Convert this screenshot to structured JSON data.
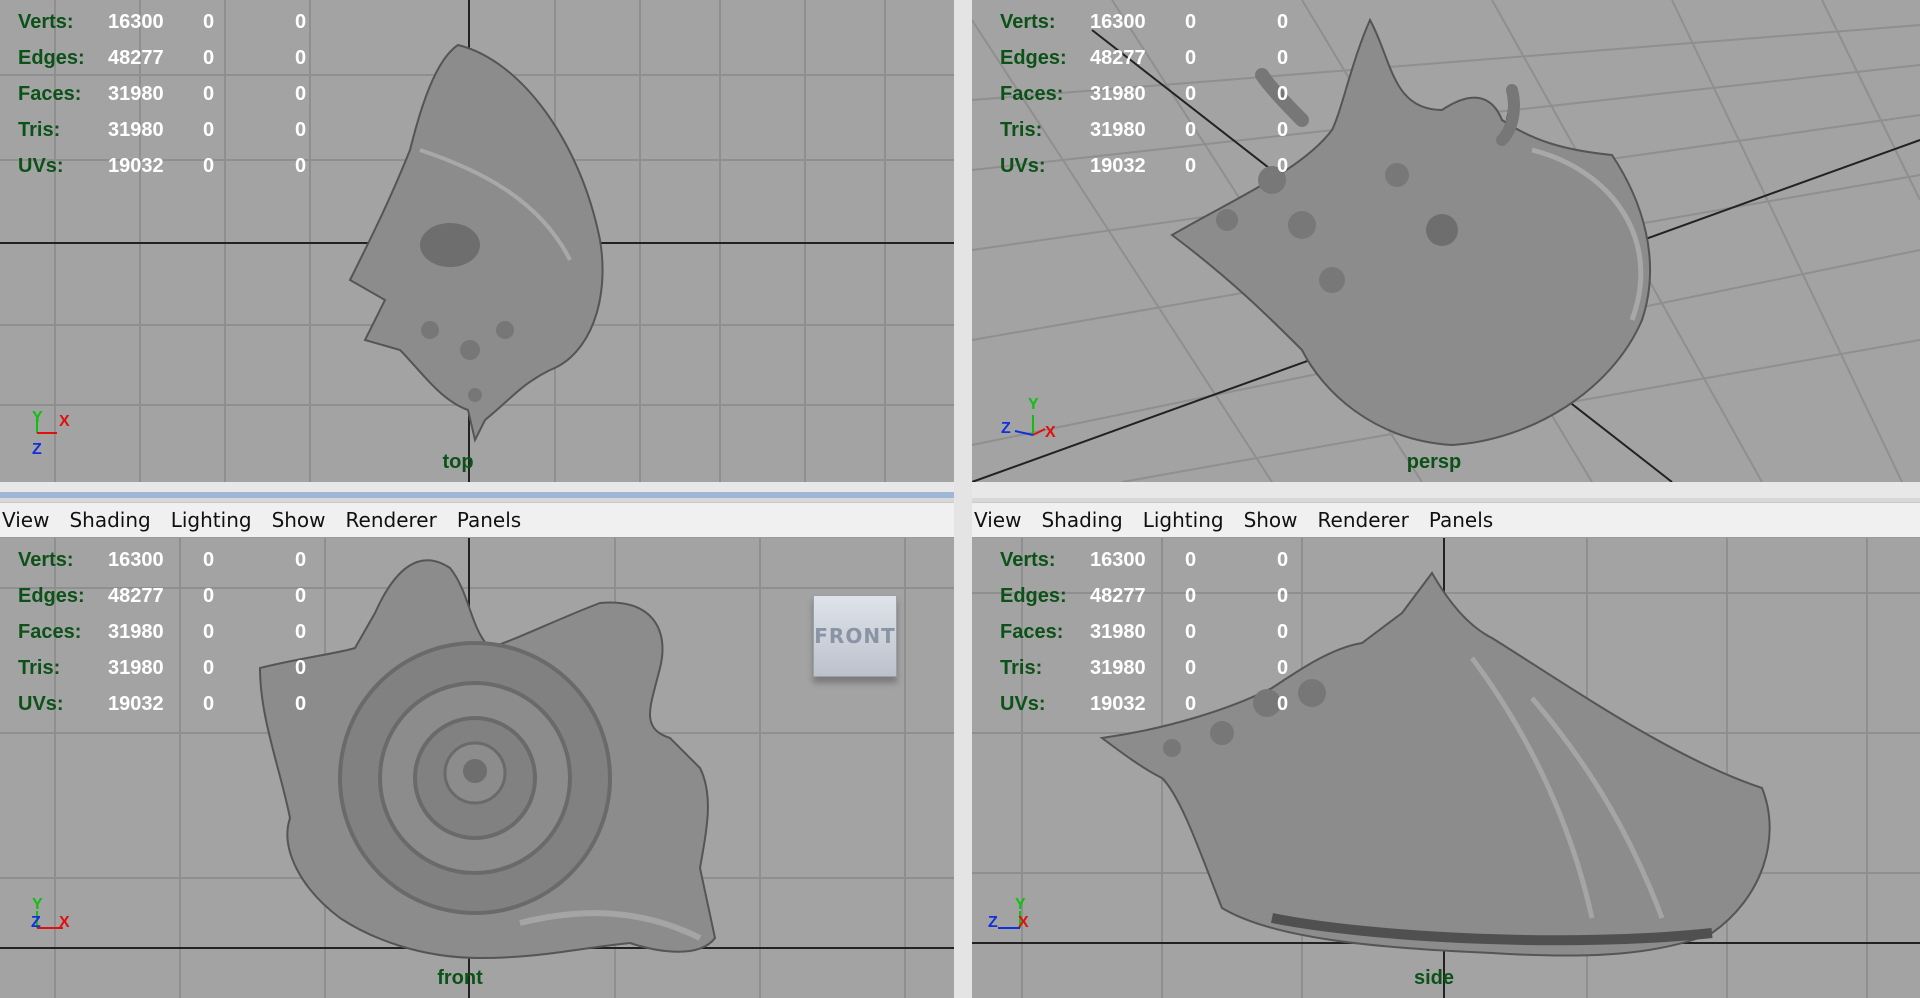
{
  "stats_rows": [
    {
      "label": "Verts:",
      "a": "16300",
      "b": "0",
      "c": "0"
    },
    {
      "label": "Edges:",
      "a": "48277",
      "b": "0",
      "c": "0"
    },
    {
      "label": "Faces:",
      "a": "31980",
      "b": "0",
      "c": "0"
    },
    {
      "label": "Tris:",
      "a": "31980",
      "b": "0",
      "c": "0"
    },
    {
      "label": "UVs:",
      "a": "19032",
      "b": "0",
      "c": "0"
    }
  ],
  "menu": [
    "View",
    "Shading",
    "Lighting",
    "Show",
    "Renderer",
    "Panels"
  ],
  "viewports": {
    "top": {
      "camera": "top"
    },
    "persp": {
      "camera": "persp"
    },
    "front": {
      "camera": "front",
      "viewcube": "FRONT"
    },
    "side": {
      "camera": "side"
    }
  },
  "axis_labels": {
    "x": "X",
    "y": "Y",
    "z": "Z"
  },
  "colors": {
    "viewport_bg": "#a3a3a3",
    "grid": "#8f8f8f",
    "axis_line": "#222222",
    "hud_label": "#0c5218",
    "hud_value": "#ffffff",
    "shell": "#8c8c8c",
    "axis_x": "#e01010",
    "axis_y": "#10c010",
    "axis_z": "#1030e0"
  }
}
